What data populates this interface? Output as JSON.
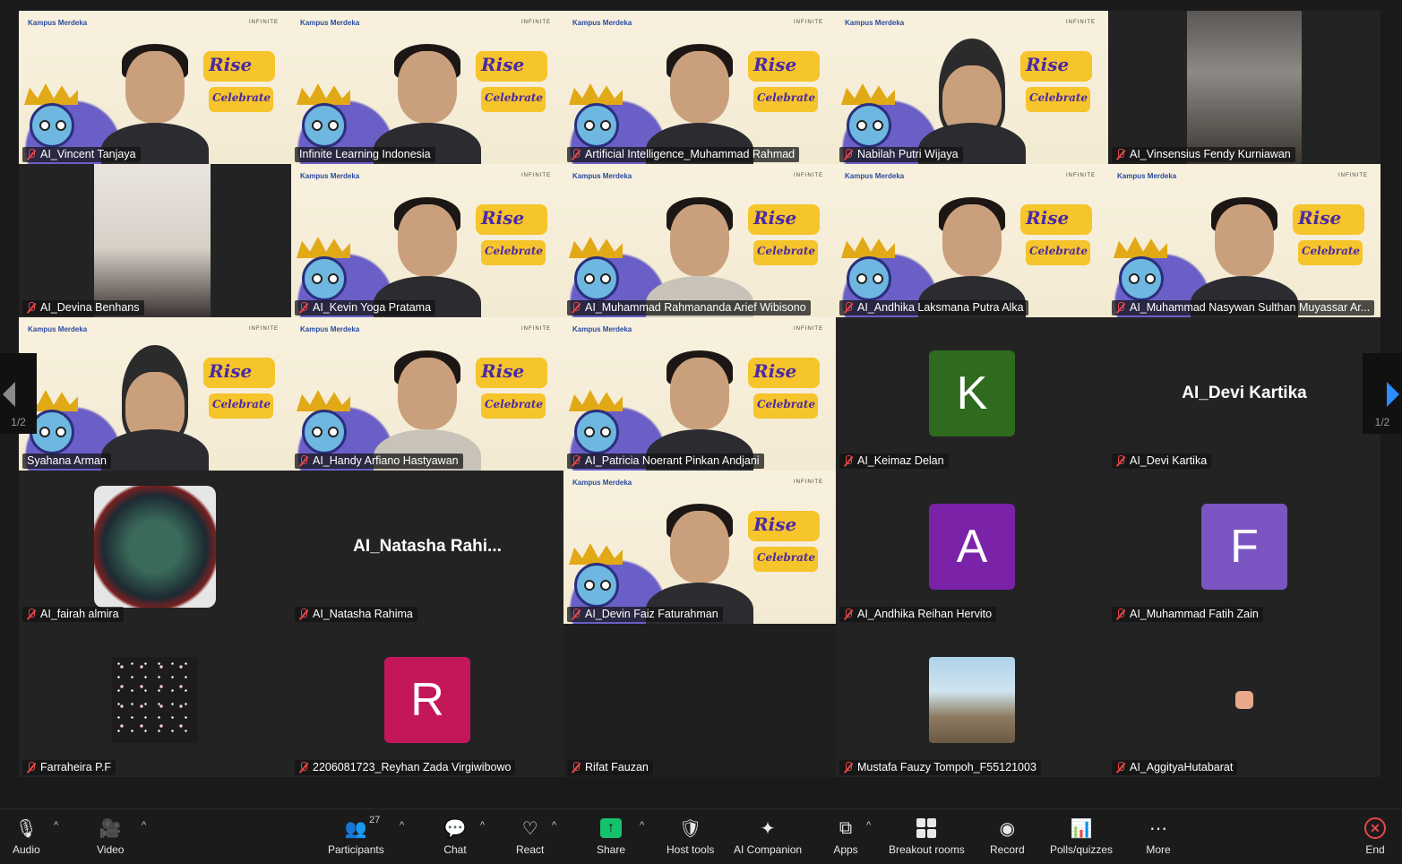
{
  "participants": [
    {
      "name": "AI_Vincent Tanjaya",
      "type": "video",
      "muted": true
    },
    {
      "name": "Infinite Learning Indonesia",
      "type": "video",
      "muted": false,
      "active": true
    },
    {
      "name": "Artificial Intelligence_Muhammad Rahmad",
      "type": "video",
      "muted": true
    },
    {
      "name": "Nabilah Putri Wijaya",
      "type": "video",
      "muted": true
    },
    {
      "name": "AI_Vinsensius Fendy Kurniawan",
      "type": "camera",
      "muted": true
    },
    {
      "name": "AI_Devina Benhans",
      "type": "camera",
      "muted": true
    },
    {
      "name": "AI_Kevin Yoga Pratama",
      "type": "video",
      "muted": true
    },
    {
      "name": "AI_Muhammad Rahmananda Arief Wibisono",
      "type": "video",
      "muted": true
    },
    {
      "name": "AI_Andhika Laksmana Putra Alka",
      "type": "video",
      "muted": true
    },
    {
      "name": "AI_Muhammad Nasywan Sulthan Muyassar Ar...",
      "type": "video",
      "muted": true
    },
    {
      "name": "Syahana Arman",
      "type": "video",
      "muted": false
    },
    {
      "name": "AI_Handy Arfiano Hastyawan",
      "type": "video",
      "muted": true
    },
    {
      "name": "AI_Patricia Noerant Pinkan Andjani",
      "type": "video",
      "muted": true
    },
    {
      "name": "AI_Keimaz Delan",
      "type": "avatar",
      "initial": "K",
      "color": "#2e6b1f",
      "muted": true
    },
    {
      "name": "AI_Devi Kartika",
      "type": "bigname",
      "bigname": "AI_Devi Kartika",
      "muted": true
    },
    {
      "name": "AI_fairah almira",
      "type": "photo",
      "muted": true
    },
    {
      "name": "AI_Natasha Rahima",
      "type": "bigname",
      "bigname": "AI_Natasha  Rahi...",
      "muted": true
    },
    {
      "name": "AI_Devin Faiz Faturahman",
      "type": "video",
      "muted": true
    },
    {
      "name": "AI_Andhika Reihan Hervito",
      "type": "avatar",
      "initial": "A",
      "color": "#7a22a8",
      "muted": true
    },
    {
      "name": "AI_Muhammad Fatih Zain",
      "type": "avatar",
      "initial": "F",
      "color": "#7b55c2",
      "muted": true
    },
    {
      "name": "Farraheira P.F",
      "type": "pattern",
      "muted": true
    },
    {
      "name": "2206081723_Reyhan Zada Virgiwibowo",
      "type": "avatar",
      "initial": "R",
      "color": "#c4175a",
      "muted": true
    },
    {
      "name": "Rifat Fauzan",
      "type": "none",
      "muted": true
    },
    {
      "name": "Mustafa Fauzy Tompoh_F55121003",
      "type": "photo2",
      "muted": true
    },
    {
      "name": "AI_AggityaHutabarat",
      "type": "dot",
      "muted": true
    }
  ],
  "banner": {
    "left_logo": "Kampus Merdeka",
    "right_logo": "INFINITE",
    "line1": "Rise",
    "line2": "Celebrate"
  },
  "pager": {
    "left": "1/2",
    "right": "1/2"
  },
  "toolbar": {
    "audio": "Audio",
    "video": "Video",
    "participants": "Participants",
    "participants_count": "27",
    "chat": "Chat",
    "react": "React",
    "share": "Share",
    "host_tools": "Host tools",
    "ai_companion": "AI Companion",
    "apps": "Apps",
    "breakout_rooms": "Breakout rooms",
    "record": "Record",
    "polls": "Polls/quizzes",
    "more": "More",
    "end": "End"
  },
  "colors": {
    "active_border": "#22d07a",
    "muted_mic": "#e8464a",
    "share": "#14c26b",
    "next_arrow": "#2d8cff"
  }
}
